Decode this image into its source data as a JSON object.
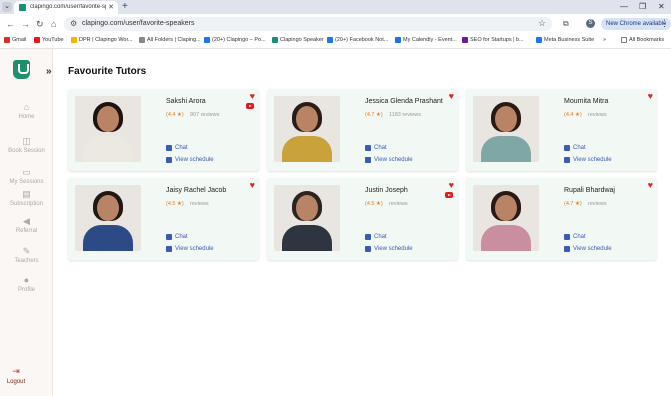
{
  "browser": {
    "tab_title": "clapingo.com/user/favorite-sp",
    "url": "clapingo.com/user/favorite-speakers",
    "new_chrome_label": "New Chrome available",
    "profile_initial": "S",
    "bookmarks": [
      {
        "label": "Gmail",
        "color": "#d93025"
      },
      {
        "label": "YouTube",
        "color": "#e21c1c"
      },
      {
        "label": "DPR | Clapingo Wor...",
        "color": "#f4b400"
      },
      {
        "label": "All Folders | Claping...",
        "color": "#888888"
      },
      {
        "label": "(20+) Clapingo – Po...",
        "color": "#1877f2"
      },
      {
        "label": "Clapingo Speaker",
        "color": "#1a8f74"
      },
      {
        "label": "(20+) Facebook Not...",
        "color": "#1877f2"
      },
      {
        "label": "My Calendly - Event...",
        "color": "#1a73e8"
      },
      {
        "label": "SEO for Startups | b...",
        "color": "#6a1b9a"
      },
      {
        "label": "Meta Business Suite",
        "color": "#1877f2"
      }
    ],
    "all_bookmarks": "All Bookmarks"
  },
  "sidebar": {
    "items": [
      {
        "label": "Home",
        "icon": "home-icon",
        "glyph": "⌂"
      },
      {
        "label": "Book Session",
        "icon": "book-icon",
        "glyph": "◫"
      },
      {
        "label": "My Sessions",
        "icon": "sessions-icon",
        "glyph": "▭"
      },
      {
        "label": "Subscription",
        "icon": "subscription-icon",
        "glyph": "▤"
      },
      {
        "label": "Referral",
        "icon": "megaphone-icon",
        "glyph": "◀"
      },
      {
        "label": "Teachers",
        "icon": "teachers-icon",
        "glyph": "✎"
      },
      {
        "label": "Profile",
        "icon": "profile-icon",
        "glyph": "●"
      }
    ],
    "logout": "Logout"
  },
  "page": {
    "title": "Favourite Tutors",
    "chat_label": "Chat",
    "schedule_label": "View schedule"
  },
  "tutors": [
    {
      "name": "Sakshi Arora",
      "rating": "(4.4 ★)",
      "reviews": "907 reviews",
      "youtube": true,
      "hair": "#1d1411",
      "body": "#ece9e3"
    },
    {
      "name": "Jessica Glenda Prashant",
      "rating": "(4.7 ★)",
      "reviews": "1183 reviews",
      "youtube": false,
      "hair": "#2b1d15",
      "body": "#c9a23a"
    },
    {
      "name": "Moumita Mitra",
      "rating": "(4.4 ★)",
      "reviews": "reviews",
      "youtube": false,
      "hair": "#2a1a14",
      "body": "#7fa7a5"
    },
    {
      "name": "Jaisy Rachel Jacob",
      "rating": "(4.5 ★)",
      "reviews": "reviews",
      "youtube": false,
      "hair": "#1f1814",
      "body": "#2c4a86"
    },
    {
      "name": "Justin Joseph",
      "rating": "(4.5 ★)",
      "reviews": "reviews",
      "youtube": true,
      "hair": "#2a2521",
      "body": "#2f3540"
    },
    {
      "name": "Rupali Bhardwaj",
      "rating": "(4.7 ★)",
      "reviews": "reviews",
      "youtube": false,
      "hair": "#2a1a14",
      "body": "#c98ea0"
    }
  ]
}
